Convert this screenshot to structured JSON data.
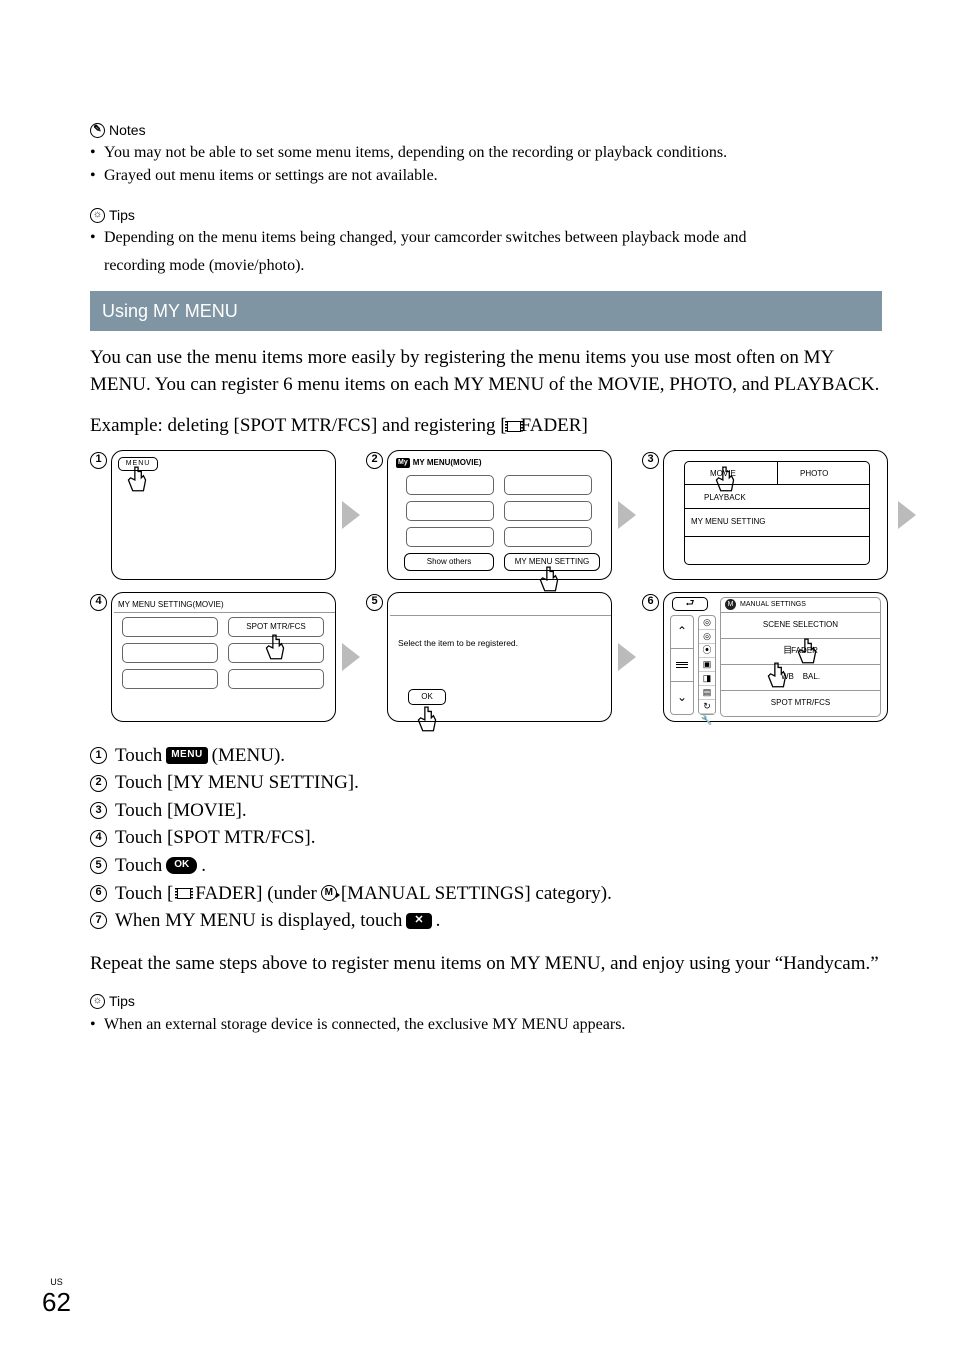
{
  "notes": {
    "heading": "Notes",
    "items": [
      "You may not be able to set some menu items, depending on the recording or playback conditions.",
      "Grayed out menu items or settings are not available."
    ]
  },
  "tips1": {
    "heading": "Tips",
    "item1_line1": "Depending on the menu items being changed, your camcorder switches between playback mode and",
    "item1_line2": "recording mode (movie/photo)."
  },
  "section_title": "Using MY MENU",
  "body_paragraph": "You can use the menu items more easily by registering the menu items you use most often on MY MENU. You can register 6 menu items on each MY MENU of the MOVIE, PHOTO, and PLAYBACK.",
  "example_line_prefix": "Example: deleting [SPOT MTR/FCS] and registering [",
  "example_line_suffix": "FADER]",
  "screens": {
    "s1": {
      "menu": "MENU"
    },
    "s2": {
      "title": "MY MENU(MOVIE)",
      "my_badge": "My",
      "show_others": "Show others",
      "my_menu_setting": "MY MENU SETTING"
    },
    "s3": {
      "movie": "MOVIE",
      "photo": "PHOTO",
      "playback": "PLAYBACK",
      "my_menu_setting": "MY MENU SETTING"
    },
    "s4": {
      "title": "MY MENU SETTING(MOVIE)",
      "spot": "SPOT MTR/FCS"
    },
    "s5": {
      "text": "Select the item to be registered.",
      "ok": "OK"
    },
    "s6": {
      "back": "⤵",
      "header": "MANUAL SETTINGS",
      "items": [
        "SCENE SELECTION",
        "FADER",
        "WB",
        "BAL.",
        "SPOT MTR/FCS"
      ],
      "m_badge": "M"
    }
  },
  "steps": {
    "s1a": "Touch ",
    "s1b": " (MENU).",
    "menu_badge": "MENU",
    "s2": "Touch [MY MENU SETTING].",
    "s3": "Touch [MOVIE].",
    "s4": "Touch [SPOT MTR/FCS].",
    "s5a": "Touch ",
    "s5b": ".",
    "ok_badge": "OK",
    "s6a": "Touch [",
    "s6b": "FADER] (under ",
    "s6c": " [MANUAL SETTINGS] category).",
    "m_letter": "M",
    "s7a": "When MY MENU is displayed, touch ",
    "s7b": ".",
    "x_badge": "✕"
  },
  "closing_paragraph": "Repeat the same steps above to register menu items on MY MENU, and enjoy using your “Handycam.”",
  "tips2": {
    "heading": "Tips",
    "items": [
      "When an external storage device is connected, the exclusive MY MENU appears."
    ]
  },
  "page": {
    "region": "US",
    "number": "62"
  }
}
